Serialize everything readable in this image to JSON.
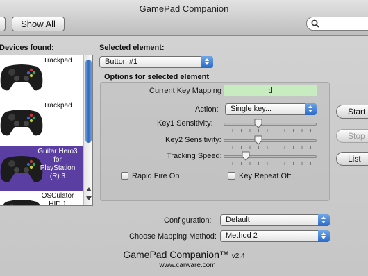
{
  "window": {
    "title": "GamePad Companion",
    "show_all_label": "Show All"
  },
  "devices": {
    "label": "Devices found:",
    "items": [
      {
        "name": "Trackpad",
        "selected": false
      },
      {
        "name": "Trackpad",
        "selected": false
      },
      {
        "name": "Guitar Hero3 for PlayStation (R) 3",
        "selected": true
      },
      {
        "name": "OSCulator HID 1",
        "selected": false
      }
    ]
  },
  "element": {
    "label": "Selected element:",
    "value": "Button #1"
  },
  "options": {
    "title": "Options for selected element",
    "current_key_label": "Current Key Mapping",
    "current_key_value": "d",
    "action_label": "Action:",
    "action_value": "Single key...",
    "key1_label": "Key1 Sensitivity:",
    "key1_level": 0.36,
    "key2_label": "Key2 Sensitivity:",
    "key2_level": 0.36,
    "tracking_label": "Tracking Speed:",
    "tracking_level": 0.21,
    "rapid_fire_label": "Rapid Fire On",
    "rapid_fire_checked": false,
    "key_repeat_label": "Key Repeat Off",
    "key_repeat_checked": false
  },
  "buttons": {
    "start": "Start",
    "stop": "Stop",
    "list": "List"
  },
  "configuration": {
    "label": "Configuration:",
    "value": "Default",
    "mapping_method_label": "Choose Mapping Method:",
    "mapping_method_value": "Method 2"
  },
  "footer": {
    "app_name": "GamePad Companion™",
    "version": "v2.4",
    "url": "www.carware.com"
  },
  "colors": {
    "selection": "#5a3ea1",
    "mapping_field": "#c6ecbf",
    "popup_accent": "#2b69c6"
  }
}
